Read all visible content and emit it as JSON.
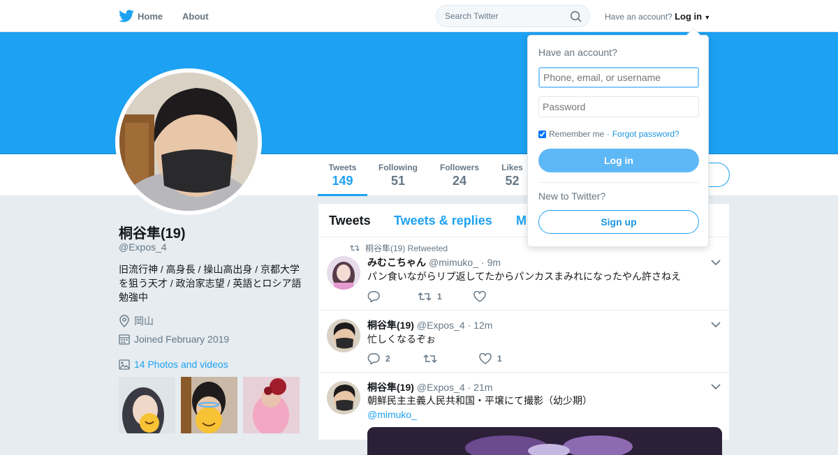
{
  "nav": {
    "home": "Home",
    "about": "About",
    "search_placeholder": "Search Twitter",
    "have_account": "Have an account?",
    "login": "Log in"
  },
  "profile": {
    "name": "桐谷隼(19)",
    "handle": "@Expos_4",
    "bio": "旧流行神 / 高身長 / 操山高出身 / 京都大学を狙う天才 / 政治家志望 / 英語とロシア語勉強中",
    "location": "岡山",
    "joined": "Joined February 2019",
    "photos": "14 Photos and videos"
  },
  "stats": [
    {
      "label": "Tweets",
      "value": "149"
    },
    {
      "label": "Following",
      "value": "51"
    },
    {
      "label": "Followers",
      "value": "24"
    },
    {
      "label": "Likes",
      "value": "52"
    }
  ],
  "tabs": [
    "Tweets",
    "Tweets & replies",
    "M"
  ],
  "tweets": [
    {
      "retweeted_by": "桐谷隼(19) Retweeted",
      "name": "みむこちゃん",
      "handle": "@mimuko_",
      "time": "· 9m",
      "text": "パン食いながらリプ返してたからパンカスまみれになったやん許さねえ",
      "replies": "",
      "retweets": "1",
      "likes": ""
    },
    {
      "retweeted_by": "",
      "name": "桐谷隼(19)",
      "handle": "@Expos_4",
      "time": "· 12m",
      "text": "忙しくなるぞぉ",
      "replies": "2",
      "retweets": "",
      "likes": "1"
    },
    {
      "retweeted_by": "",
      "name": "桐谷隼(19)",
      "handle": "@Expos_4",
      "time": "· 21m",
      "text": "朝鮮民主主義人民共和国・平壌にて撮影（幼少期）",
      "link": "@mimuko_"
    }
  ],
  "login_dropdown": {
    "title": "Have an account?",
    "username_placeholder": "Phone, email, or username",
    "password_placeholder": "Password",
    "remember": "Remember me ·",
    "forgot": "Forgot password?",
    "login_button": "Log in",
    "new_to_twitter": "New to Twitter?",
    "signup_button": "Sign up"
  },
  "colors": {
    "brand": "#1da1f2",
    "background": "#e6ecf0"
  }
}
